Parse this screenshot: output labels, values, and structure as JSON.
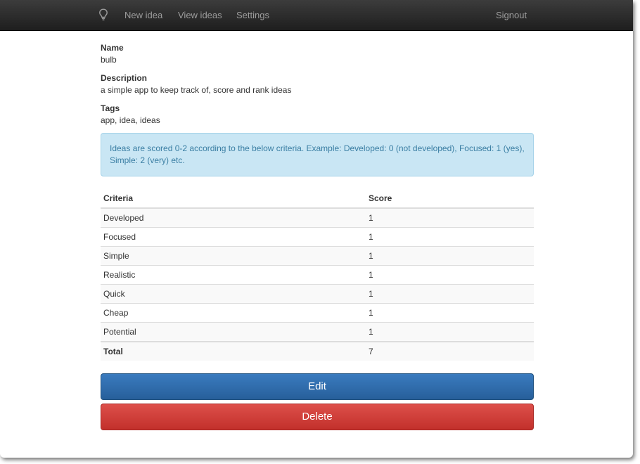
{
  "navbar": {
    "brand_icon": "lightbulb-icon",
    "links": [
      {
        "label": "New idea"
      },
      {
        "label": "View ideas"
      },
      {
        "label": "Settings"
      }
    ],
    "signout_label": "Signout",
    "colors": {
      "background": "#2a2a2a",
      "link": "#9d9d9d"
    }
  },
  "idea": {
    "name_label": "Name",
    "name": "bulb",
    "description_label": "Description",
    "description": "a simple app to keep track of, score and rank ideas",
    "tags_label": "Tags",
    "tags": "app, idea, ideas"
  },
  "info_alert": {
    "text": "Ideas are scored 0-2 according to the below criteria. Example: Developed: 0 (not developed), Focused: 1 (yes), Simple: 2 (very) etc.",
    "colors": {
      "background": "#c9e6f4",
      "text": "#3a7ea3"
    }
  },
  "criteria_table": {
    "headers": {
      "criteria": "Criteria",
      "score": "Score"
    },
    "rows": [
      {
        "criteria": "Developed",
        "score": "1"
      },
      {
        "criteria": "Focused",
        "score": "1"
      },
      {
        "criteria": "Simple",
        "score": "1"
      },
      {
        "criteria": "Realistic",
        "score": "1"
      },
      {
        "criteria": "Quick",
        "score": "1"
      },
      {
        "criteria": "Cheap",
        "score": "1"
      },
      {
        "criteria": "Potential",
        "score": "1"
      }
    ],
    "total": {
      "label": "Total",
      "score": "7"
    }
  },
  "actions": {
    "edit_label": "Edit",
    "delete_label": "Delete",
    "colors": {
      "edit": "#2f6dac",
      "delete": "#d2403b"
    }
  }
}
